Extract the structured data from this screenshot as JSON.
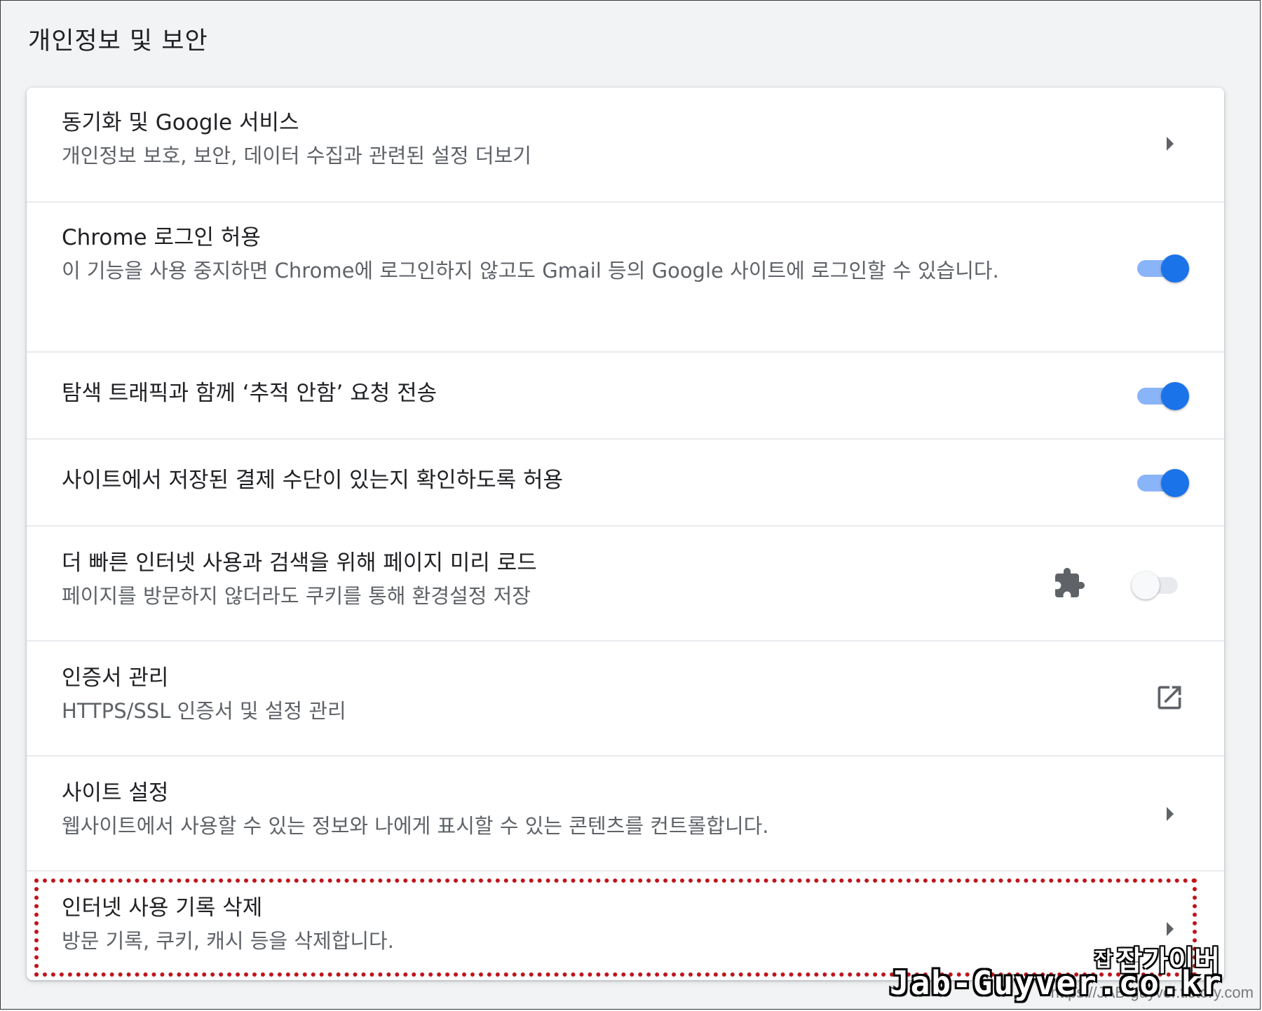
{
  "section": {
    "title": "개인정보 및 보안"
  },
  "rows": [
    {
      "label": "동기화 및 Google 서비스",
      "sub": "개인정보 보호, 보안, 데이터 수집과 관련된 설정 더보기",
      "control": "arrow"
    },
    {
      "label": "Chrome 로그인 허용",
      "sub": "이 기능을 사용 중지하면 Chrome에 로그인하지 않고도 Gmail 등의 Google 사이트에 로그인할 수 있습니다.",
      "control": "toggle",
      "checked": true
    },
    {
      "label": "탐색 트래픽과 함께 ‘추적 안함’ 요청 전송",
      "control": "toggle",
      "checked": true
    },
    {
      "label": "사이트에서 저장된 결제 수단이 있는지 확인하도록 허용",
      "control": "toggle",
      "checked": true
    },
    {
      "label": "더 빠른 인터넷 사용과 검색을 위해 페이지 미리 로드",
      "sub": "페이지를 방문하지 않더라도 쿠키를 통해 환경설정 저장",
      "control": "toggle",
      "checked": false,
      "extension_icon": "puzzle-icon"
    },
    {
      "label": "인증서 관리",
      "sub": "HTTPS/SSL 인증서 및 설정 관리",
      "control": "external-link-icon"
    },
    {
      "label": "사이트 설정",
      "sub": "웹사이트에서 사용할 수 있는 정보와 나에게 표시할 수 있는 콘텐츠를 컨트롤합니다.",
      "control": "arrow"
    },
    {
      "label": "인터넷 사용 기록 삭제",
      "sub": "방문 기록, 쿠키, 캐시 등을 삭제합니다.",
      "control": "arrow",
      "highlighted": true
    }
  ],
  "watermark": {
    "prefix": "잡",
    "korean": "잡가이버",
    "domain": "Jab-Guyver.co.kr",
    "url": "https://JAB-guyver.tistory.com"
  },
  "colors": {
    "toggle_on_track": "#8ab4f8",
    "toggle_on_knob": "#1a73e8",
    "highlight_border": "#c0141b"
  }
}
